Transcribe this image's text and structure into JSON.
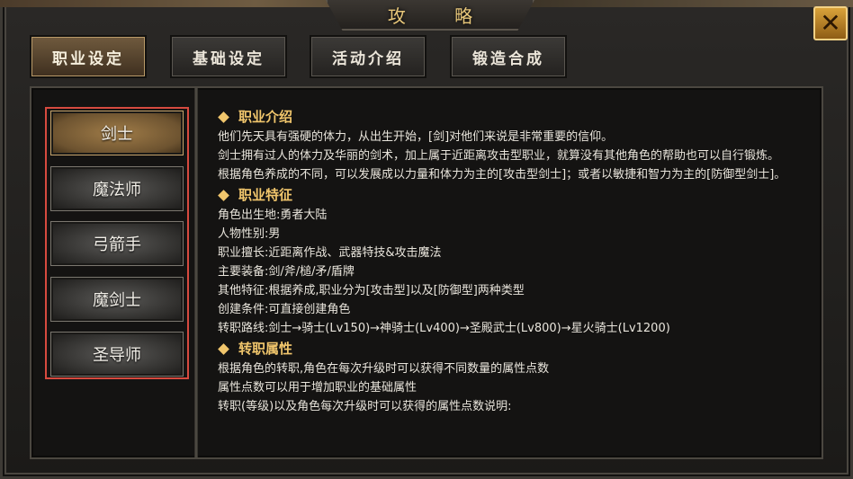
{
  "window": {
    "title": "攻 略"
  },
  "close_symbol": "✕",
  "tabs": [
    {
      "label": "职业设定",
      "active": true
    },
    {
      "label": "基础设定",
      "active": false
    },
    {
      "label": "活动介绍",
      "active": false
    },
    {
      "label": "锻造合成",
      "active": false
    }
  ],
  "classes": [
    {
      "label": "剑士",
      "active": true
    },
    {
      "label": "魔法师",
      "active": false
    },
    {
      "label": "弓箭手",
      "active": false
    },
    {
      "label": "魔剑士",
      "active": false
    },
    {
      "label": "圣导师",
      "active": false
    }
  ],
  "guide": {
    "sections": [
      {
        "heading": "职业介绍",
        "lines": [
          "他们先天具有强硬的体力，从出生开始，[剑]对他们来说是非常重要的信仰。",
          "剑士拥有过人的体力及华丽的剑术，加上属于近距离攻击型职业，就算没有其他角色的帮助也可以自行锻炼。",
          "根据角色养成的不同，可以发展成以力量和体力为主的[攻击型剑士]；或者以敏捷和智力为主的[防御型剑士]。"
        ]
      },
      {
        "heading": "职业特征",
        "lines": [
          "角色出生地:勇者大陆",
          "人物性别:男",
          "职业擅长:近距离作战、武器特技&攻击魔法",
          "主要装备:剑/斧/槌/矛/盾牌",
          "其他特征:根据养成,职业分为[攻击型]以及[防御型]两种类型",
          "创建条件:可直接创建角色",
          "转职路线:剑士→骑士(Lv150)→神骑士(Lv400)→圣殿武士(Lv800)→星火骑士(Lv1200)"
        ]
      },
      {
        "heading": "转职属性",
        "lines": [
          "根据角色的转职,角色在每次升级时可以获得不同数量的属性点数",
          "属性点数可以用于增加职业的基础属性",
          "转职(等级)以及角色每次升级时可以获得的属性点数说明:"
        ]
      }
    ]
  },
  "colors": {
    "heading": "#f1c66c",
    "body_text": "#e9e5dc",
    "selection_border": "#d64a3f",
    "close_button": "#d9a23a"
  }
}
